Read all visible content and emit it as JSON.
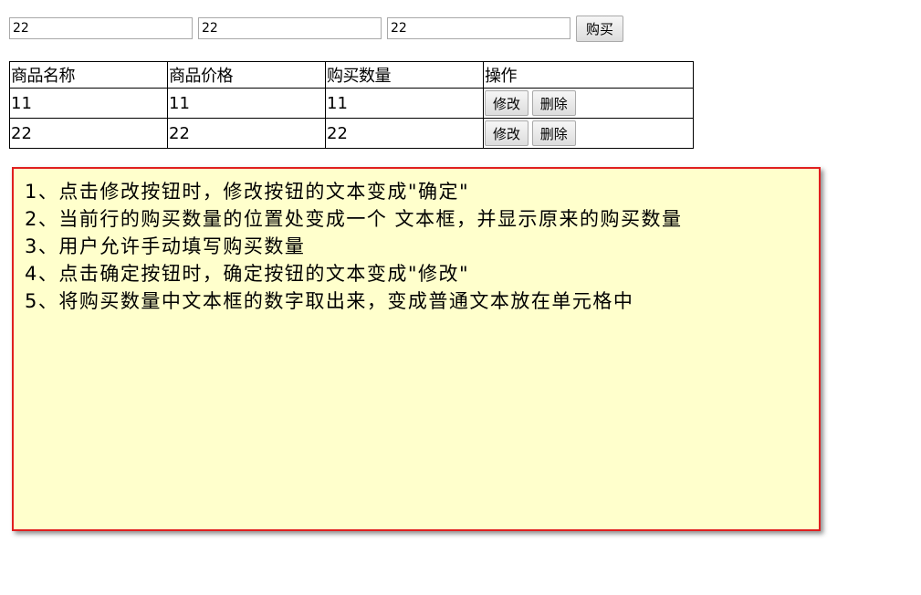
{
  "form": {
    "field1_value": "22",
    "field2_value": "22",
    "field3_value": "22",
    "buy_label": "购买"
  },
  "table": {
    "headers": [
      "商品名称",
      "商品价格",
      "购买数量",
      "操作"
    ],
    "rows": [
      {
        "name": "11",
        "price": "11",
        "qty": "11",
        "edit_label": "修改",
        "delete_label": "删除"
      },
      {
        "name": "22",
        "price": "22",
        "qty": "22",
        "edit_label": "修改",
        "delete_label": "删除"
      }
    ]
  },
  "notes": {
    "lines": [
      "1、点击修改按钮时，修改按钮的文本变成\"确定\"",
      "2、当前行的购买数量的位置处变成一个 文本框，并显示原来的购买数量",
      "3、用户允许手动填写购买数量",
      "4、点击确定按钮时，确定按钮的文本变成\"修改\"",
      "5、将购买数量中文本框的数字取出来，变成普通文本放在单元格中"
    ],
    "background_color": "#ffffcc",
    "border_color": "#e02020"
  }
}
